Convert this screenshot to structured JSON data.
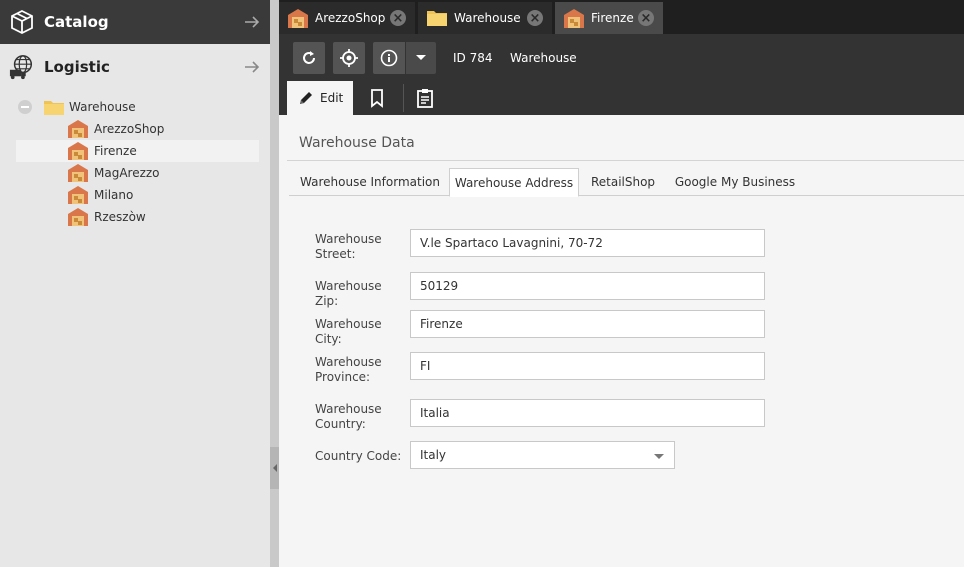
{
  "sidebar": {
    "catalog_title": "Catalog",
    "logistic_title": "Logistic",
    "tree": {
      "root_label": "Warehouse",
      "children": [
        {
          "label": "ArezzoShop"
        },
        {
          "label": "Firenze",
          "selected": true
        },
        {
          "label": "MagArezzo"
        },
        {
          "label": "Milano"
        },
        {
          "label": "Rzeszòw"
        }
      ]
    }
  },
  "tabs": [
    {
      "label": "ArezzoShop",
      "icon": "warehouse-icon"
    },
    {
      "label": "Warehouse",
      "icon": "folder-icon"
    },
    {
      "label": "Firenze",
      "icon": "warehouse-icon",
      "active": true
    }
  ],
  "toolbar": {
    "id_text": "ID 784",
    "type_text": "Warehouse"
  },
  "subtabs": {
    "edit_label": "Edit"
  },
  "content": {
    "section_title": "Warehouse Data",
    "form_tabs": [
      {
        "label": "Warehouse Information"
      },
      {
        "label": "Warehouse Address",
        "active": true
      },
      {
        "label": "RetailShop"
      },
      {
        "label": "Google My Business"
      }
    ],
    "fields": {
      "street": {
        "label": "Warehouse Street:",
        "value": "V.le Spartaco Lavagnini, 70-72"
      },
      "zip": {
        "label": "Warehouse Zip:",
        "value": "50129"
      },
      "city": {
        "label": "Warehouse City:",
        "value": "Firenze"
      },
      "province": {
        "label": "Warehouse Province:",
        "value": "FI"
      },
      "country": {
        "label": "Warehouse Country:",
        "value": "Italia"
      },
      "country_code": {
        "label": "Country Code:",
        "value": "Italy"
      }
    }
  },
  "colors": {
    "sidebar_bg": "#e7e7e7",
    "header_dark": "#3a3a3a",
    "tabbar_bg": "#1f1f1f",
    "toolbar_bg": "#333333",
    "content_bg": "#f5f5f5",
    "warehouse_icon_orange": "#d9774a"
  }
}
